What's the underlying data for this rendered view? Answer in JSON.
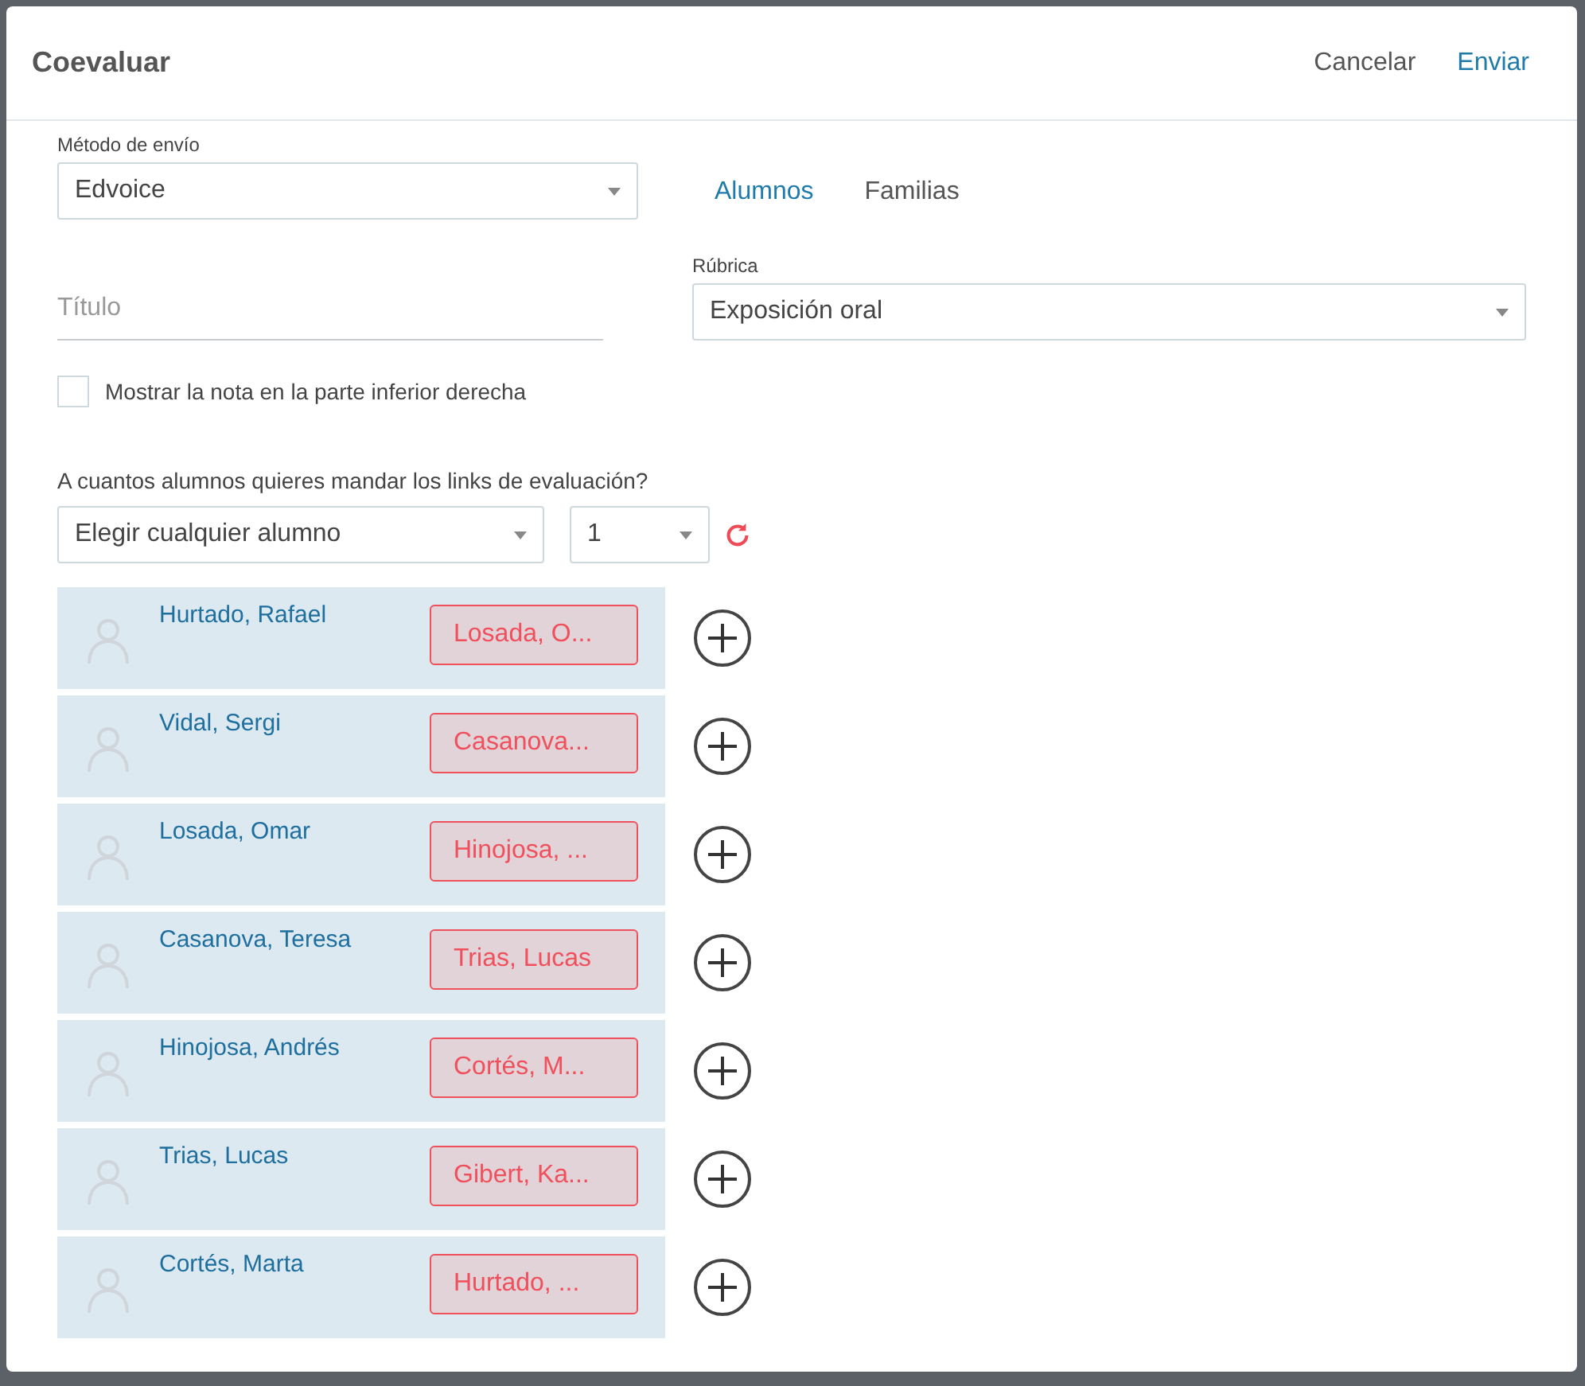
{
  "dialog": {
    "title": "Coevaluar",
    "actions": [
      {
        "label": "Cancelar",
        "kind": "secondary"
      },
      {
        "label": "Enviar",
        "kind": "primary"
      }
    ]
  },
  "send_method": {
    "label": "Método de envío",
    "value": "Edvoice"
  },
  "tabs": [
    {
      "label": "Alumnos",
      "selected": true
    },
    {
      "label": "Familias",
      "selected": false
    }
  ],
  "title_field": {
    "placeholder": "Título"
  },
  "rubric": {
    "label": "Rúbrica",
    "value": "Exposición oral"
  },
  "show_grade": {
    "label": "Mostrar la nota en la parte inferior derecha",
    "checked": false
  },
  "question": "A cuantos alumnos quieres mandar los links de evaluación?",
  "student_select": {
    "value": "Elegir cualquier alumno"
  },
  "count_select": {
    "value": "1"
  },
  "students": [
    {
      "name": "Hurtado, Rafael",
      "assigned": "Losada, O..."
    },
    {
      "name": "Vidal, Sergi",
      "assigned": "Casanova..."
    },
    {
      "name": "Losada, Omar",
      "assigned": "Hinojosa, ..."
    },
    {
      "name": "Casanova, Teresa",
      "assigned": "Trias, Lucas"
    },
    {
      "name": "Hinojosa, Andrés",
      "assigned": "Cortés, M..."
    },
    {
      "name": "Trias, Lucas",
      "assigned": "Gibert, Ka..."
    },
    {
      "name": "Cortés, Marta",
      "assigned": "Hurtado, ..."
    }
  ]
}
